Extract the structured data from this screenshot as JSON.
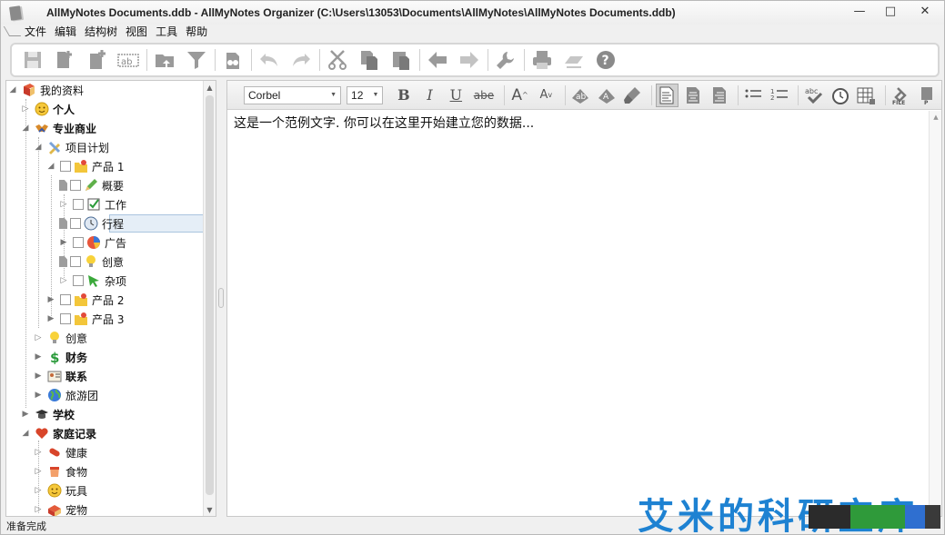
{
  "window": {
    "title": "AllMyNotes Documents.ddb - AllMyNotes Organizer (C:\\Users\\13053\\Documents\\AllMyNotes\\AllMyNotes Documents.ddb)",
    "minimize": "—",
    "maximize": "□",
    "close": "✕"
  },
  "menu": [
    "文件",
    "编辑",
    "结构树",
    "视图",
    "工具",
    "帮助"
  ],
  "toolbar": {
    "icons": [
      "save-icon",
      "add-note-icon",
      "add-child-note-icon",
      "rename-icon",
      "folder-up-icon",
      "filter-icon",
      "attach-icon",
      "undo-icon",
      "redo-icon",
      "cut-icon",
      "copy-icon",
      "paste-icon",
      "back-arrow-icon",
      "forward-arrow-icon",
      "wrench-icon",
      "print-icon",
      "export-icon",
      "help-icon"
    ]
  },
  "tree": {
    "nodes": [
      {
        "label": "我的资料",
        "bold": false,
        "icon": "book-icon"
      },
      {
        "label": "个人",
        "bold": true,
        "icon": "smiley-icon"
      },
      {
        "label": "专业商业",
        "bold": true,
        "icon": "handshake-icon"
      },
      {
        "label": "项目计划",
        "bold": false,
        "icon": "pencil-ruler-icon"
      },
      {
        "label": "产品 1",
        "bold": false,
        "icon": "folder-star-icon"
      },
      {
        "label": "概要",
        "bold": false,
        "icon": "pencil-icon"
      },
      {
        "label": "工作",
        "bold": false,
        "icon": "checkbox-icon"
      },
      {
        "label": "行程",
        "bold": false,
        "icon": "clock-icon"
      },
      {
        "label": "广告",
        "bold": false,
        "icon": "chart-pie-icon"
      },
      {
        "label": "创意",
        "bold": false,
        "icon": "lightbulb-icon"
      },
      {
        "label": "杂项",
        "bold": false,
        "icon": "green-arrow-icon"
      },
      {
        "label": "产品 2",
        "bold": false,
        "icon": "folder-star-icon"
      },
      {
        "label": "产品 3",
        "bold": false,
        "icon": "folder-star-icon"
      },
      {
        "label": "创意",
        "bold": false,
        "icon": "lightbulb-icon"
      },
      {
        "label": "财务",
        "bold": true,
        "icon": "dollar-icon"
      },
      {
        "label": "联系",
        "bold": true,
        "icon": "contact-card-icon"
      },
      {
        "label": "旅游团",
        "bold": false,
        "icon": "globe-icon"
      },
      {
        "label": "学校",
        "bold": true,
        "icon": "graduation-cap-icon"
      },
      {
        "label": "家庭记录",
        "bold": true,
        "icon": "heart-icon"
      },
      {
        "label": "健康",
        "bold": false,
        "icon": "pill-icon"
      },
      {
        "label": "食物",
        "bold": false,
        "icon": "cup-icon"
      },
      {
        "label": "玩具",
        "bold": false,
        "icon": "smiley-icon"
      },
      {
        "label": "宠物",
        "bold": false,
        "icon": "pet-icon"
      }
    ]
  },
  "format": {
    "font": "Corbel",
    "size": "12"
  },
  "editor": {
    "text": "这是一个范例文字. 你可以在这里开始建立您的数据..."
  },
  "status": "准备完成",
  "watermark": "艾米的科研宝库",
  "colors": {
    "accent": "#1e82d2",
    "selection": "#e5eef7"
  }
}
